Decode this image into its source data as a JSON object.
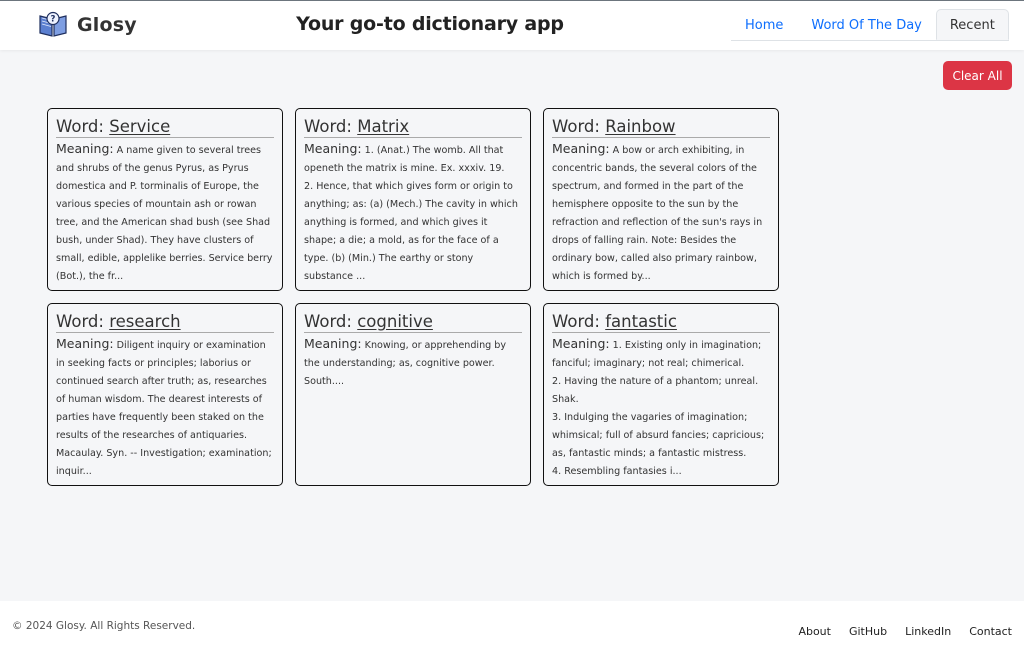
{
  "header": {
    "brand": "Glosy",
    "title": "Your go-to dictionary app",
    "tabs": [
      {
        "label": "Home"
      },
      {
        "label": "Word Of The Day"
      },
      {
        "label": "Recent"
      }
    ]
  },
  "actions": {
    "clear_all_label": "Clear All"
  },
  "card_labels": {
    "word": "Word:",
    "meaning": "Meaning:"
  },
  "cards": [
    {
      "word": "Service",
      "meaning": "A name given to several trees and shrubs of the genus Pyrus, as Pyrus domestica and P. torminalis of Europe, the various species of mountain ash or rowan tree, and the American shad bush (see Shad bush, under Shad). They have clusters of small, edible, applelike berries. Service berry (Bot.), the fr..."
    },
    {
      "word": "Matrix",
      "meaning": "1. (Anat.) The womb. All that openeth the matrix is mine. Ex. xxxiv. 19.\n2. Hence, that which gives form or origin to anything; as: (a) (Mech.) The cavity in which anything is formed, and which gives it shape; a die; a mold, as for the face of a type. (b) (Min.) The earthy or stony substance ..."
    },
    {
      "word": "Rainbow",
      "meaning": "A bow or arch exhibiting, in concentric bands, the several colors of the spectrum, and formed in the part of the hemisphere opposite to the sun by the refraction and reflection of the sun's rays in drops of falling rain. Note: Besides the ordinary bow, called also primary rainbow, which is formed by..."
    },
    {
      "word": "research",
      "meaning": "Diligent inquiry or examination in seeking facts or principles; laborius or continued search after truth; as, researches of human wisdom. The dearest interests of parties have frequently been staked on the results of the researches of antiquaries. Macaulay. Syn. -- Investigation; examination; inquir..."
    },
    {
      "word": "cognitive",
      "meaning": "Knowing, or apprehending by the understanding; as, cognitive power. South...."
    },
    {
      "word": "fantastic",
      "meaning": "1. Existing only in imagination; fanciful; imaginary; not real; chimerical.\n2. Having the nature of a phantom; unreal. Shak.\n3. Indulging the vagaries of imagination; whimsical; full of absurd fancies; capricious; as, fantastic minds; a fantastic mistress.\n4. Resembling fantasies i..."
    }
  ],
  "footer": {
    "copyright": "© 2024 Glosy. All Rights Reserved.",
    "links": [
      {
        "label": "About"
      },
      {
        "label": "GitHub"
      },
      {
        "label": "LinkedIn"
      },
      {
        "label": "Contact"
      }
    ]
  },
  "colors": {
    "accent": "#0d6efd",
    "danger": "#dc3545",
    "background": "#f5f6f8"
  },
  "icons": {
    "logo": "dictionary-book-icon"
  }
}
